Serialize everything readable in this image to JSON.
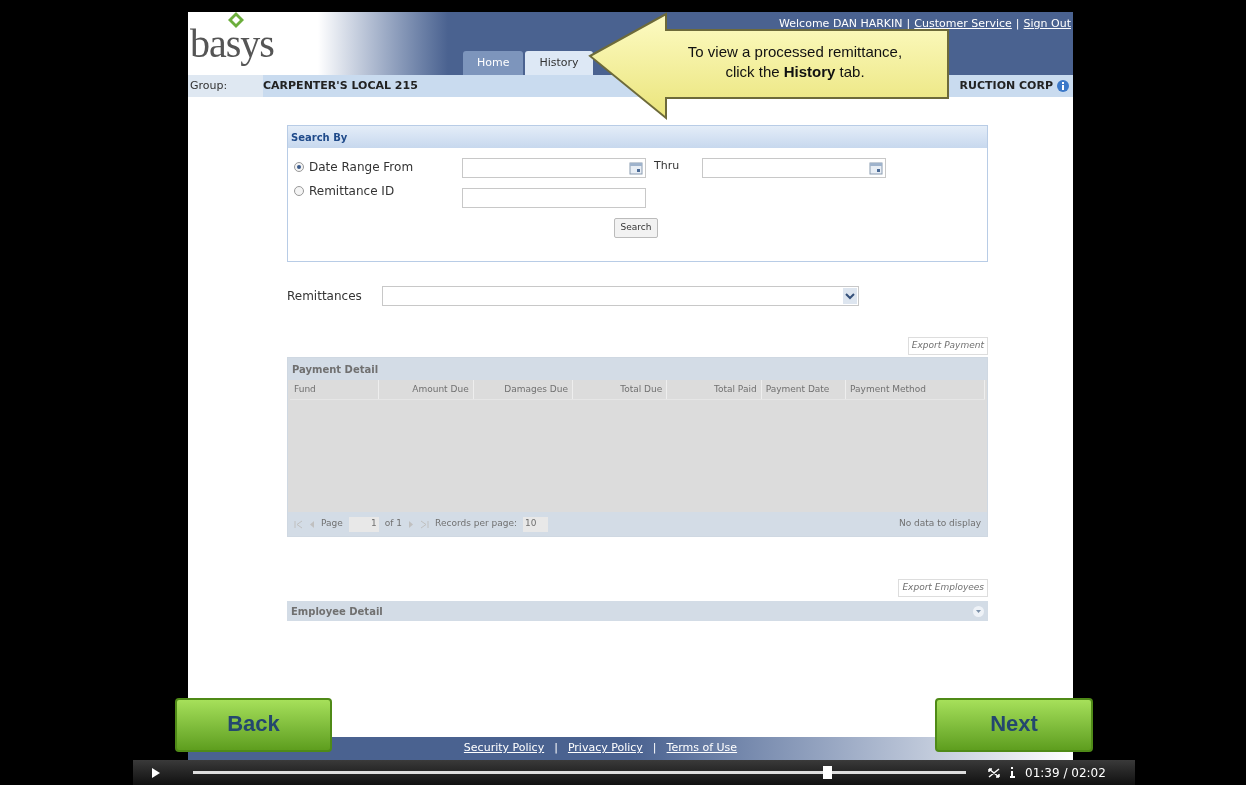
{
  "header": {
    "welcome": "Welcome DAN HARKIN",
    "separator": "|",
    "links": [
      "Customer Service",
      "Sign Out"
    ],
    "tabs": [
      {
        "label": "Home",
        "selected": false
      },
      {
        "label": "History",
        "selected": true
      }
    ]
  },
  "logo": {
    "text": "basys"
  },
  "group_bar": {
    "label": "Group:",
    "value": "CARPENTER'S LOCAL 215",
    "employer": "RUCTION CORP"
  },
  "callout": {
    "lines": [
      "To view a processed remittance,",
      "click the **History** tab."
    ]
  },
  "search_panel": {
    "title": "Search By",
    "options": [
      {
        "label": "Date Range From",
        "selected": true
      },
      {
        "label": "Remittance ID",
        "selected": false
      }
    ],
    "thru_label": "Thru",
    "button": "Search"
  },
  "remittances": {
    "label": "Remittances"
  },
  "payment_detail": {
    "export_button": "Export Payment",
    "title": "Payment Detail",
    "disabled": true,
    "columns": [
      "Fund",
      "Amount Due",
      "Damages Due",
      "Total Due",
      "Total Paid",
      "Payment Date",
      "Payment Method"
    ],
    "pager": {
      "page_label": "Page",
      "page_value": "1",
      "of": "of 1",
      "records_label": "Records per page:",
      "records_value": "10",
      "empty": "No data to display"
    }
  },
  "employee_detail": {
    "export_button": "Export Employees",
    "title": "Employee Detail",
    "disabled": true
  },
  "footer": {
    "separator": "|",
    "links": [
      "Security Policy",
      "Privacy Policy",
      "Terms of Use"
    ]
  },
  "nav": {
    "back": "Back",
    "next": "Next"
  },
  "player": {
    "level": 0.82,
    "time": "01:39 / 02:02"
  }
}
